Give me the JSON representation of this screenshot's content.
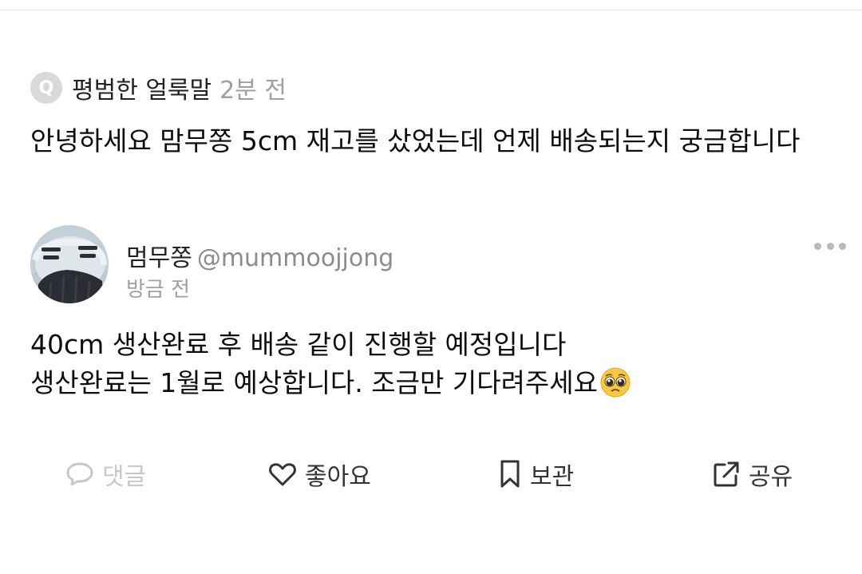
{
  "question": {
    "badge": "Q",
    "author": "평범한 얼룩말",
    "time": "2분 전",
    "text": "안녕하세요 맘무쫑 5cm 재고를 샀었는데 언제 배송되는지 궁금합니다"
  },
  "answer": {
    "author": "멈무쫑",
    "handle": "@mummoojjong",
    "time": "방금 전",
    "lines": [
      "40cm 생산완료 후 배송 같이 진행할 예정입니다",
      "생산완료는 1월로 예상합니다. 조금만 기다려주세요"
    ],
    "emoji": "pleading-face-emoji"
  },
  "actions": {
    "comment": "댓글",
    "like": "좋아요",
    "save": "보관",
    "share": "공유"
  },
  "icons": [
    "comment-icon",
    "heart-icon",
    "bookmark-icon",
    "share-icon",
    "more-icon"
  ],
  "colors": {
    "text": "#111111",
    "muted": "#a0a0a0",
    "disabled": "#c8c8c8",
    "action": "#333333"
  }
}
